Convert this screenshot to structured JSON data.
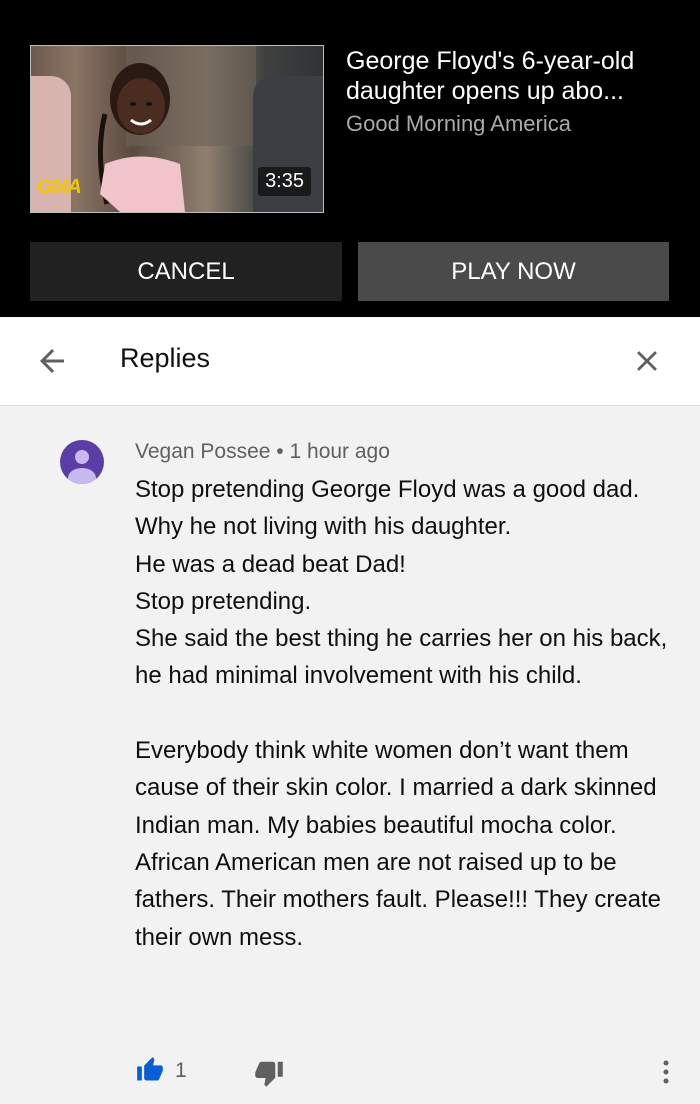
{
  "miniplayer": {
    "video_title": "George Floyd's 6-year-old daughter opens up abo...",
    "channel": "Good Morning America",
    "duration": "3:35",
    "thumbnail_logo_text": "GMA",
    "cancel_label": "CANCEL",
    "play_now_label": "PLAY NOW"
  },
  "header": {
    "title": "Replies",
    "back_icon": "arrow-back-icon",
    "close_icon": "close-icon"
  },
  "comment": {
    "author": "Vegan Possee",
    "separator": "•",
    "time": "1 hour ago",
    "text": "Stop pretending George Floyd was a good dad. Why he not living with his daughter.\nHe was a dead beat Dad!\nStop pretending.\nShe said the best thing he carries her on his back, he had minimal  involvement with his child.\n\nEverybody think white women don’t want them cause of their skin color. I married a dark skinned Indian man. My babies beautiful mocha color.\nAfrican American men are not raised up to be fathers. Their mothers fault. Please!!! They create their own mess.",
    "like_count": "1"
  },
  "colors": {
    "accent_blue": "#065fd4",
    "avatar_bg": "#5a3ea5",
    "top_bg": "#000000"
  }
}
